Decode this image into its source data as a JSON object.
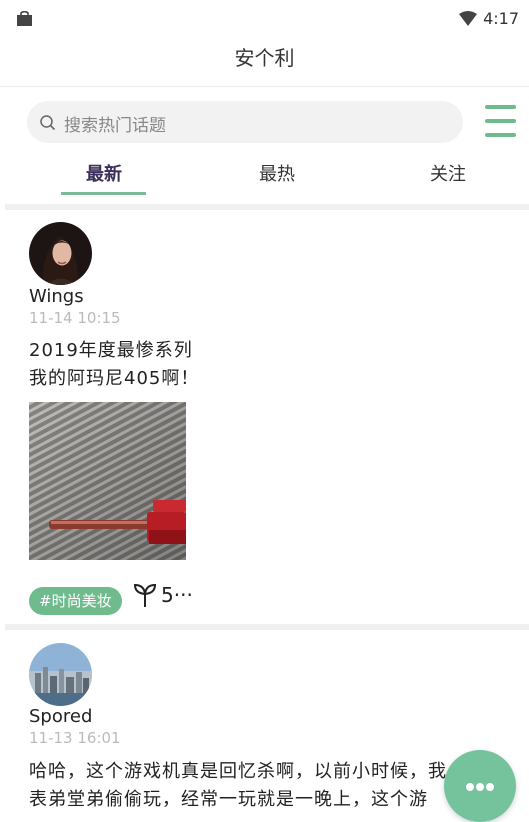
{
  "status": {
    "time": "4:17"
  },
  "header": {
    "title": "安个利"
  },
  "search": {
    "placeholder": "搜索热门话题"
  },
  "tabs": [
    {
      "label": "最新",
      "active": true
    },
    {
      "label": "最热",
      "active": false
    },
    {
      "label": "关注",
      "active": false
    }
  ],
  "posts": [
    {
      "username": "Wings",
      "time": "11-14 10:15",
      "lines": [
        "2019年度最惨系列",
        "我的阿玛尼405啊！"
      ],
      "tag": "#时尚美妆",
      "likes": "5···"
    },
    {
      "username": "Spored",
      "time": "11-13 16:01",
      "lines": [
        "哈哈，这个游戏机真是回忆杀啊，以前小时候，我",
        "表弟堂弟偷偷玩，经常一玩就是一晚上，这个游"
      ]
    }
  ],
  "colors": {
    "accent": "#6fbb8d",
    "fab": "#74c39c",
    "active_tab": "#3c2f5a"
  }
}
